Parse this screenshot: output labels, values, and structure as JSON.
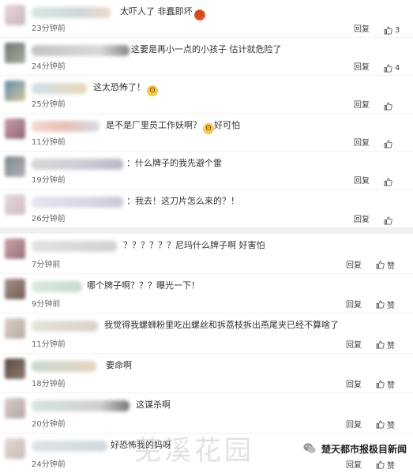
{
  "labels": {
    "reply": "回复",
    "like": "赞"
  },
  "panel1": [
    {
      "text": "太吓人了 非蠢即坏",
      "emoji": "angry",
      "time": "23分钟前",
      "likes": "3"
    },
    {
      "text": "这要是再小一点的小孩子 估计就危险了",
      "emoji": "",
      "time": "24分钟前",
      "likes": "4"
    },
    {
      "text": "这太恐怖了！",
      "emoji": "shock",
      "time": "25分钟前",
      "likes": ""
    },
    {
      "text": "是不是厂里员工作妖啊？",
      "emoji": "shock",
      "suffix": "好可怕",
      "time": "11分钟前",
      "likes": ""
    },
    {
      "text": "：什么牌子的我先避个雷",
      "emoji": "",
      "time": "19分钟前",
      "likes": ""
    },
    {
      "text": "：我去！这刀片怎么来的？！",
      "emoji": "",
      "time": "26分钟前",
      "likes": ""
    }
  ],
  "panel2": [
    {
      "text": "？？？？？？尼玛什么牌子啊 好害怕",
      "time": "7分钟前"
    },
    {
      "text": "哪个牌子啊？？？曝光一下！",
      "time": "9分钟前"
    },
    {
      "text": "我觉得我螺蛳粉里吃出螺丝和拆荔枝拆出燕尾夹已经不算啥了",
      "time": "11分钟前"
    },
    {
      "text": "要命啊",
      "time": "18分钟前"
    },
    {
      "text": "这谋杀啊",
      "time": "20分钟前"
    },
    {
      "text": "好恐怖我的妈呀",
      "time": "24分钟前"
    }
  ],
  "source": "楚天都市报极目新闻",
  "watermark": "芜溪花园",
  "colors": {
    "divider": "#f0f0f0",
    "text": "#333333",
    "meta": "#666666"
  }
}
